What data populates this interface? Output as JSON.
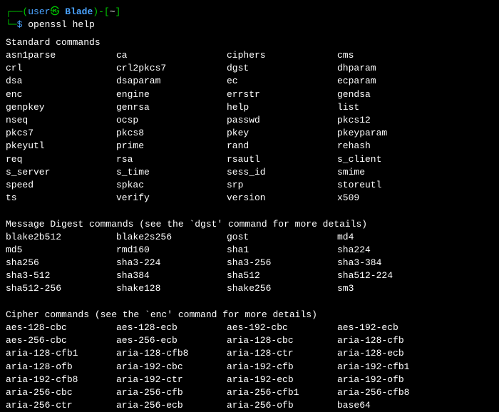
{
  "prompt": {
    "lparen": "┌──(",
    "user": "user",
    "at": "㉿",
    "host": " Blade",
    "rparen": ")-",
    "lbracket": "[",
    "path": "~",
    "rbracket": "]",
    "line2prefix": "└─",
    "sym": "$",
    "command": " openssl help"
  },
  "sections": {
    "standard": {
      "title": "Standard commands",
      "rows": [
        [
          "asn1parse",
          "ca",
          "ciphers",
          "cms"
        ],
        [
          "crl",
          "crl2pkcs7",
          "dgst",
          "dhparam"
        ],
        [
          "dsa",
          "dsaparam",
          "ec",
          "ecparam"
        ],
        [
          "enc",
          "engine",
          "errstr",
          "gendsa"
        ],
        [
          "genpkey",
          "genrsa",
          "help",
          "list"
        ],
        [
          "nseq",
          "ocsp",
          "passwd",
          "pkcs12"
        ],
        [
          "pkcs7",
          "pkcs8",
          "pkey",
          "pkeyparam"
        ],
        [
          "pkeyutl",
          "prime",
          "rand",
          "rehash"
        ],
        [
          "req",
          "rsa",
          "rsautl",
          "s_client"
        ],
        [
          "s_server",
          "s_time",
          "sess_id",
          "smime"
        ],
        [
          "speed",
          "spkac",
          "srp",
          "storeutl"
        ],
        [
          "ts",
          "verify",
          "version",
          "x509"
        ]
      ]
    },
    "digest": {
      "title": "Message Digest commands (see the `dgst' command for more details)",
      "rows": [
        [
          "blake2b512",
          "blake2s256",
          "gost",
          "md4"
        ],
        [
          "md5",
          "rmd160",
          "sha1",
          "sha224"
        ],
        [
          "sha256",
          "sha3-224",
          "sha3-256",
          "sha3-384"
        ],
        [
          "sha3-512",
          "sha384",
          "sha512",
          "sha512-224"
        ],
        [
          "sha512-256",
          "shake128",
          "shake256",
          "sm3"
        ]
      ]
    },
    "cipher": {
      "title": "Cipher commands (see the `enc' command for more details)",
      "rows": [
        [
          "aes-128-cbc",
          "aes-128-ecb",
          "aes-192-cbc",
          "aes-192-ecb"
        ],
        [
          "aes-256-cbc",
          "aes-256-ecb",
          "aria-128-cbc",
          "aria-128-cfb"
        ],
        [
          "aria-128-cfb1",
          "aria-128-cfb8",
          "aria-128-ctr",
          "aria-128-ecb"
        ],
        [
          "aria-128-ofb",
          "aria-192-cbc",
          "aria-192-cfb",
          "aria-192-cfb1"
        ],
        [
          "aria-192-cfb8",
          "aria-192-ctr",
          "aria-192-ecb",
          "aria-192-ofb"
        ],
        [
          "aria-256-cbc",
          "aria-256-cfb",
          "aria-256-cfb1",
          "aria-256-cfb8"
        ],
        [
          "aria-256-ctr",
          "aria-256-ecb",
          "aria-256-ofb",
          "base64"
        ]
      ]
    }
  }
}
